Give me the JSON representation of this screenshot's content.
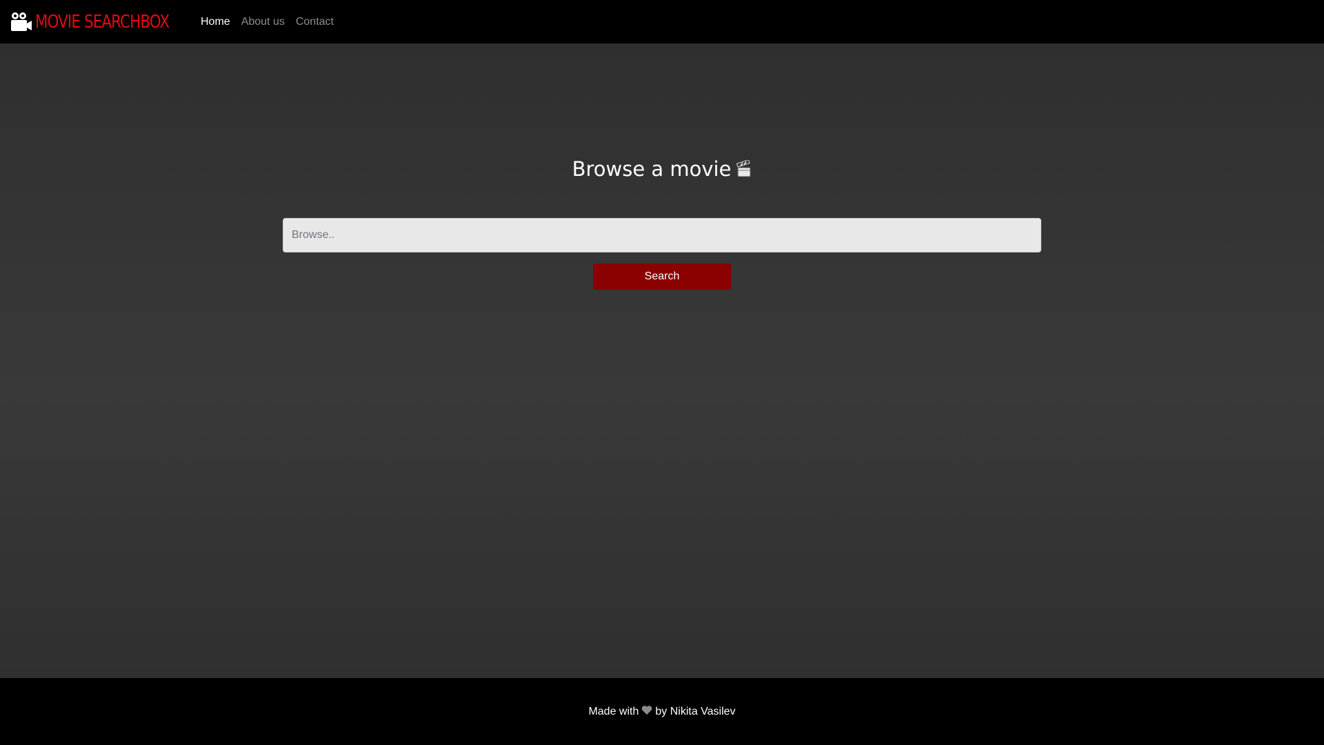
{
  "navbar": {
    "brand": "MOVIE SEARCHBOX",
    "brand_icon": "video-camera-icon",
    "links": [
      {
        "label": "Home",
        "active": true
      },
      {
        "label": "About us",
        "active": false
      },
      {
        "label": "Contact",
        "active": false
      }
    ]
  },
  "main": {
    "heading": "Browse a movie",
    "heading_icon": "clapperboard-icon",
    "search": {
      "value": "",
      "placeholder": "Browse.."
    },
    "search_button": "Search"
  },
  "footer": {
    "prefix": "Made with",
    "icon": "heart-icon",
    "suffix": "by Nikita Vasilev"
  },
  "colors": {
    "brand": "#e50914",
    "button": "#8b0000",
    "background": "#333333",
    "bar": "#000000"
  }
}
